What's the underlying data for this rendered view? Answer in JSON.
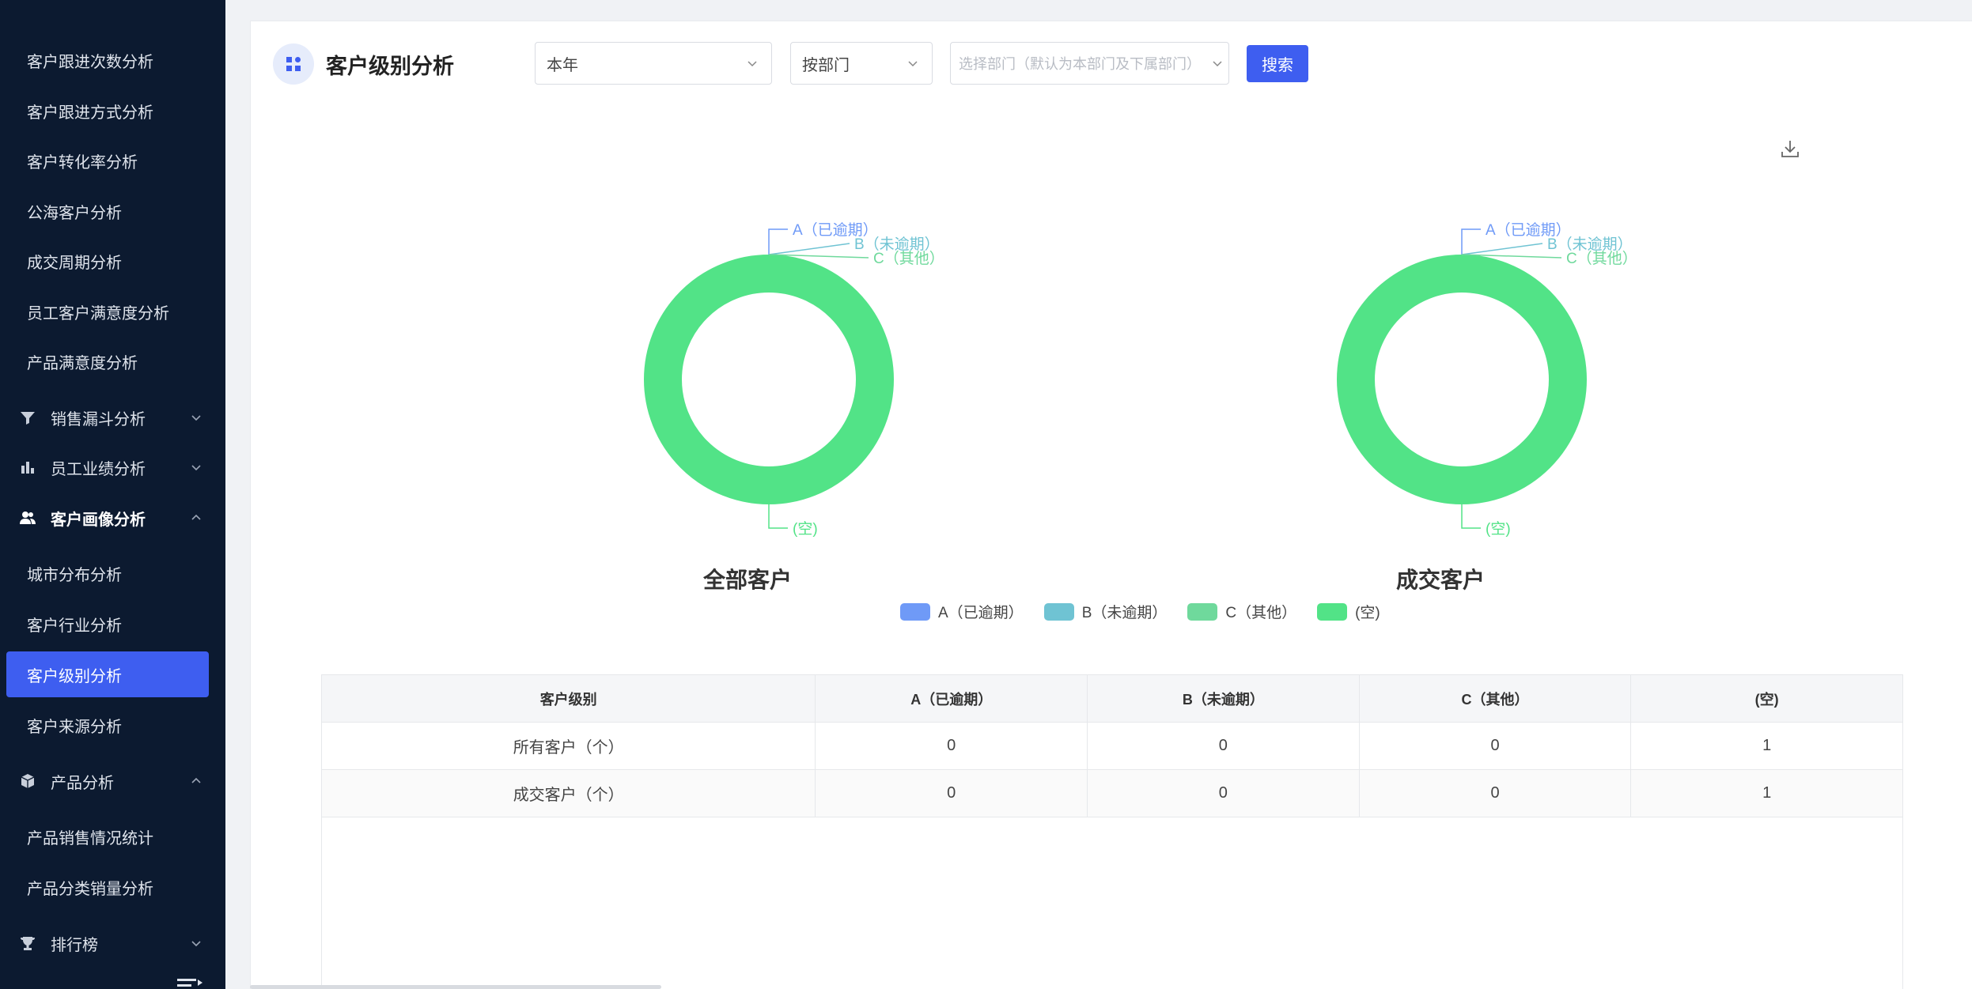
{
  "sidebar": {
    "items": [
      {
        "label": "客户跟进次数分析"
      },
      {
        "label": "客户跟进方式分析"
      },
      {
        "label": "客户转化率分析"
      },
      {
        "label": "公海客户分析"
      },
      {
        "label": "成交周期分析"
      },
      {
        "label": "员工客户满意度分析"
      },
      {
        "label": "产品满意度分析"
      }
    ],
    "groups": [
      {
        "label": "销售漏斗分析",
        "icon": "funnel-icon",
        "expanded": false
      },
      {
        "label": "员工业绩分析",
        "icon": "bar-chart-icon",
        "expanded": false
      },
      {
        "label": "客户画像分析",
        "icon": "users-icon",
        "expanded": true
      },
      {
        "label": "产品分析",
        "icon": "cube-icon",
        "expanded": true
      },
      {
        "label": "排行榜",
        "icon": "trophy-icon",
        "expanded": false
      }
    ],
    "portrait_items": [
      {
        "label": "城市分布分析"
      },
      {
        "label": "客户行业分析"
      },
      {
        "label": "客户级别分析",
        "active": true
      },
      {
        "label": "客户来源分析"
      }
    ],
    "product_items": [
      {
        "label": "产品销售情况统计"
      },
      {
        "label": "产品分类销量分析"
      }
    ]
  },
  "header": {
    "title": "客户级别分析",
    "icon": "grid-icon"
  },
  "filters": {
    "period": {
      "value": "本年"
    },
    "scope": {
      "value": "按部门"
    },
    "department": {
      "placeholder": "选择部门（默认为本部门及下属部门）"
    },
    "search_label": "搜索"
  },
  "colors": {
    "accent": "#3e5ef0",
    "sidebar_bg": "#0c1a30",
    "A": "#6f9af7",
    "B": "#6fc3d3",
    "C": "#6fd99c",
    "empty": "#52e387"
  },
  "chart_data": [
    {
      "type": "pie",
      "title": "全部客户",
      "categories": [
        "A（已逾期）",
        "B（未逾期）",
        "C（其他）",
        "(空)"
      ],
      "values": [
        0,
        0,
        0,
        1
      ]
    },
    {
      "type": "pie",
      "title": "成交客户",
      "categories": [
        "A（已逾期）",
        "B（未逾期）",
        "C（其他）",
        "(空)"
      ],
      "values": [
        0,
        0,
        0,
        1
      ]
    }
  ],
  "legend": [
    "A（已逾期）",
    "B（未逾期）",
    "C（其他）",
    "(空)"
  ],
  "table": {
    "headers": [
      "客户级别",
      "A（已逾期）",
      "B（未逾期）",
      "C（其他）",
      "(空)"
    ],
    "rows": [
      [
        "所有客户（个）",
        "0",
        "0",
        "0",
        "1"
      ],
      [
        "成交客户（个）",
        "0",
        "0",
        "0",
        "1"
      ]
    ]
  }
}
